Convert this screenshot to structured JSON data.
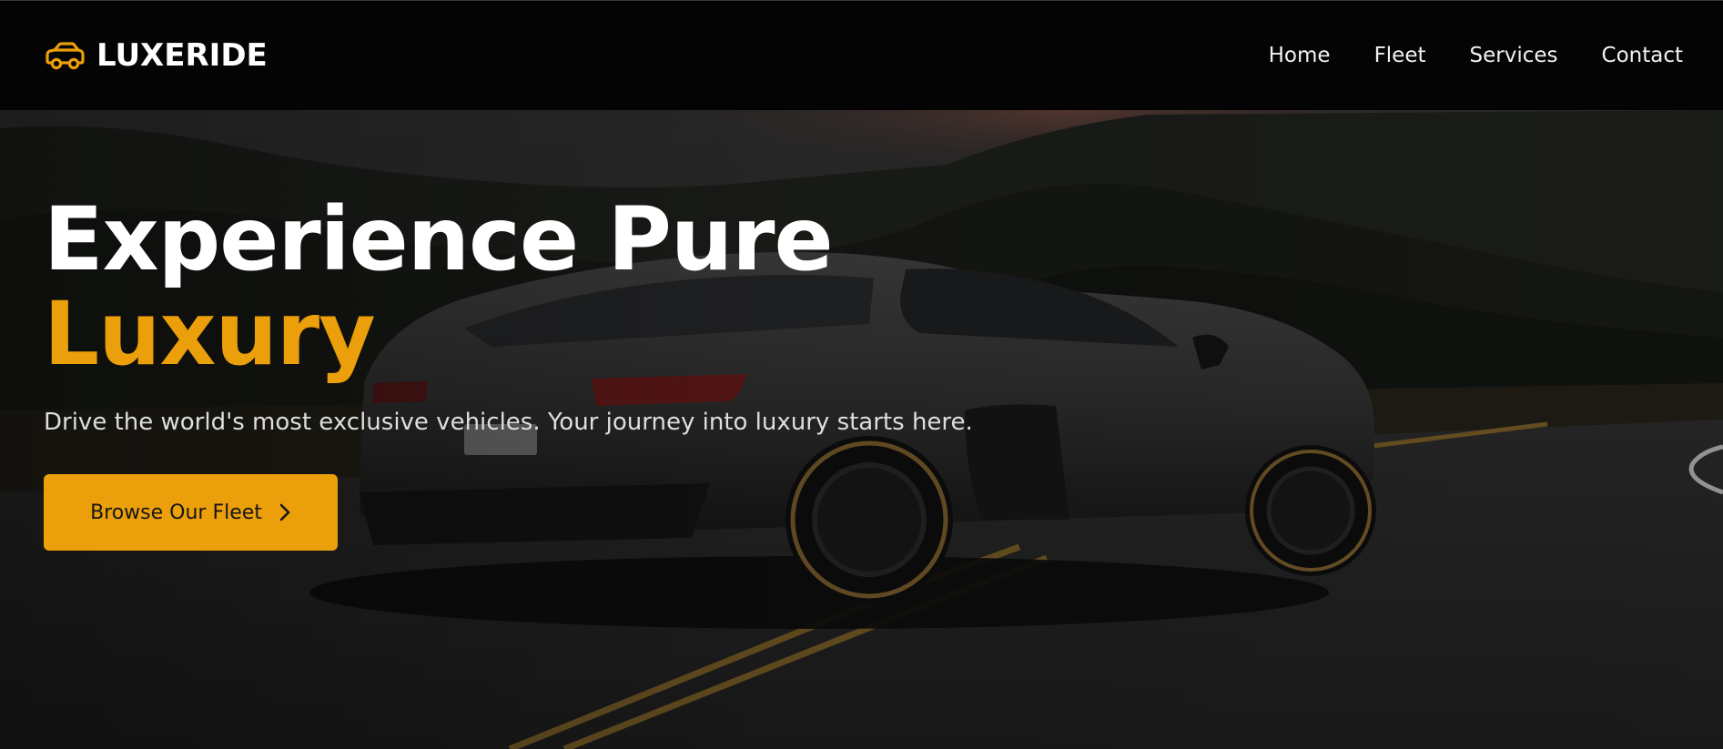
{
  "header": {
    "brand_icon": "car-icon",
    "brand_name": "LUXERIDE",
    "nav": [
      {
        "label": "Home"
      },
      {
        "label": "Fleet"
      },
      {
        "label": "Services"
      },
      {
        "label": "Contact"
      }
    ]
  },
  "hero": {
    "title_line1": "Experience Pure",
    "title_line2": "Luxury",
    "subtitle": "Drive the world's most exclusive vehicles. Your journey into luxury starts here.",
    "cta_label": "Browse Our Fleet",
    "cta_icon": "chevron-right-icon",
    "background": "dark-sports-car-on-road-image"
  },
  "colors": {
    "accent": "#eb9f0a",
    "nav_background": "#040404",
    "text": "#ffffff"
  }
}
